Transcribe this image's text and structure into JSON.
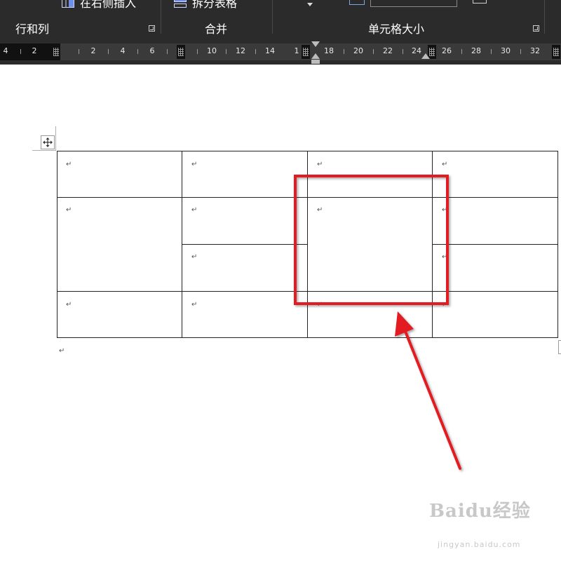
{
  "ribbon": {
    "insert_right_label": "在右侧插入",
    "split_table_label": "拆分表格",
    "groups": {
      "rows_cols": "行和列",
      "merge": "合并",
      "cell_size": "单元格大小"
    }
  },
  "ruler": {
    "labels": [
      "4",
      "2",
      "2",
      "4",
      "6",
      "10",
      "12",
      "14",
      "1",
      "18",
      "20",
      "22",
      "24",
      "26",
      "28",
      "30",
      "32"
    ]
  },
  "document": {
    "paragraph_mark": "↵"
  },
  "annotation": {
    "highlight_color": "#e31b23"
  },
  "watermark": {
    "brand": "Baidu经验",
    "url": "jingyan.baidu.com"
  }
}
